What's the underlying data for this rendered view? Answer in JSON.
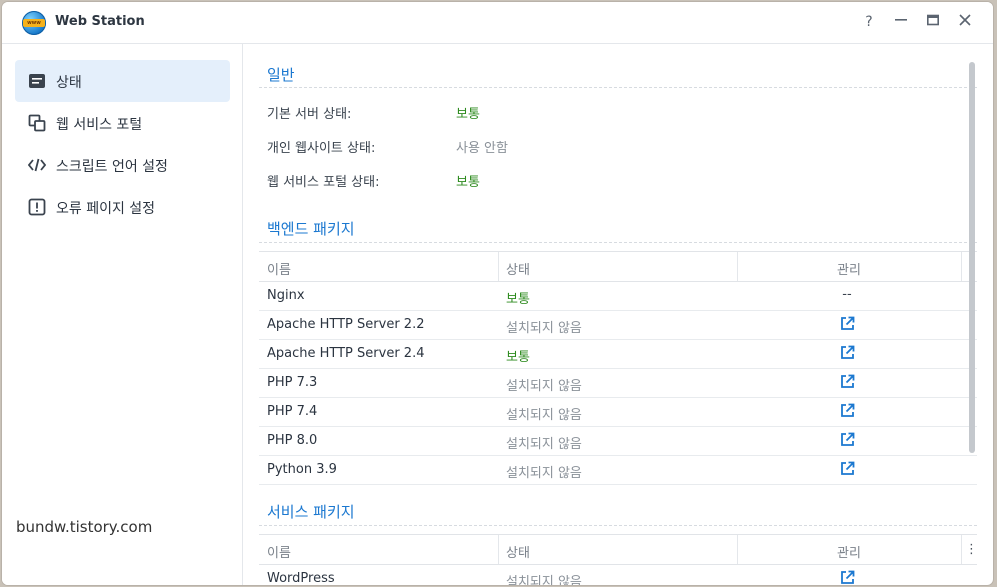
{
  "window": {
    "title": "Web Station",
    "controls": {
      "help": "?",
      "minimize": "—",
      "maximize": "▭",
      "close": "✕"
    }
  },
  "sidebar": {
    "items": [
      {
        "label": "상태",
        "icon": "status-icon",
        "active": true
      },
      {
        "label": "웹 서비스 포털",
        "icon": "portal-icon",
        "active": false
      },
      {
        "label": "스크립트 언어 설정",
        "icon": "code-icon",
        "active": false
      },
      {
        "label": "오류 페이지 설정",
        "icon": "alert-icon",
        "active": false
      }
    ]
  },
  "watermark": "bundw.tistory.com",
  "general": {
    "title": "일반",
    "rows": [
      {
        "label": "기본 서버 상태:",
        "value": "보통",
        "state": "ok"
      },
      {
        "label": "개인 웹사이트 상태:",
        "value": "사용 안함",
        "state": "off"
      },
      {
        "label": "웹 서비스 포털 상태:",
        "value": "보통",
        "state": "ok"
      }
    ]
  },
  "backend": {
    "title": "백엔드 패키지",
    "headers": {
      "name": "이름",
      "status": "상태",
      "manage": "관리"
    },
    "rows": [
      {
        "name": "Nginx",
        "status": "보통",
        "state": "ok",
        "manage": "--"
      },
      {
        "name": "Apache HTTP Server 2.2",
        "status": "설치되지 않음",
        "state": "off",
        "manage": "external-link-icon"
      },
      {
        "name": "Apache HTTP Server 2.4",
        "status": "보통",
        "state": "ok",
        "manage": "external-link-icon"
      },
      {
        "name": "PHP 7.3",
        "status": "설치되지 않음",
        "state": "off",
        "manage": "external-link-icon"
      },
      {
        "name": "PHP 7.4",
        "status": "설치되지 않음",
        "state": "off",
        "manage": "external-link-icon"
      },
      {
        "name": "PHP 8.0",
        "status": "설치되지 않음",
        "state": "off",
        "manage": "external-link-icon"
      },
      {
        "name": "Python 3.9",
        "status": "설치되지 않음",
        "state": "off",
        "manage": "external-link-icon"
      }
    ]
  },
  "service": {
    "title": "서비스 패키지",
    "headers": {
      "name": "이름",
      "status": "상태",
      "manage": "관리",
      "more": "⋮"
    },
    "rows": [
      {
        "name": "WordPress",
        "status": "설치되지 않음",
        "state": "off",
        "manage": "external-link-icon"
      }
    ]
  },
  "colors": {
    "accent": "#1b78d0",
    "ok": "#2e8b1f",
    "muted": "#8a9199",
    "active_bg": "#e4effb"
  }
}
